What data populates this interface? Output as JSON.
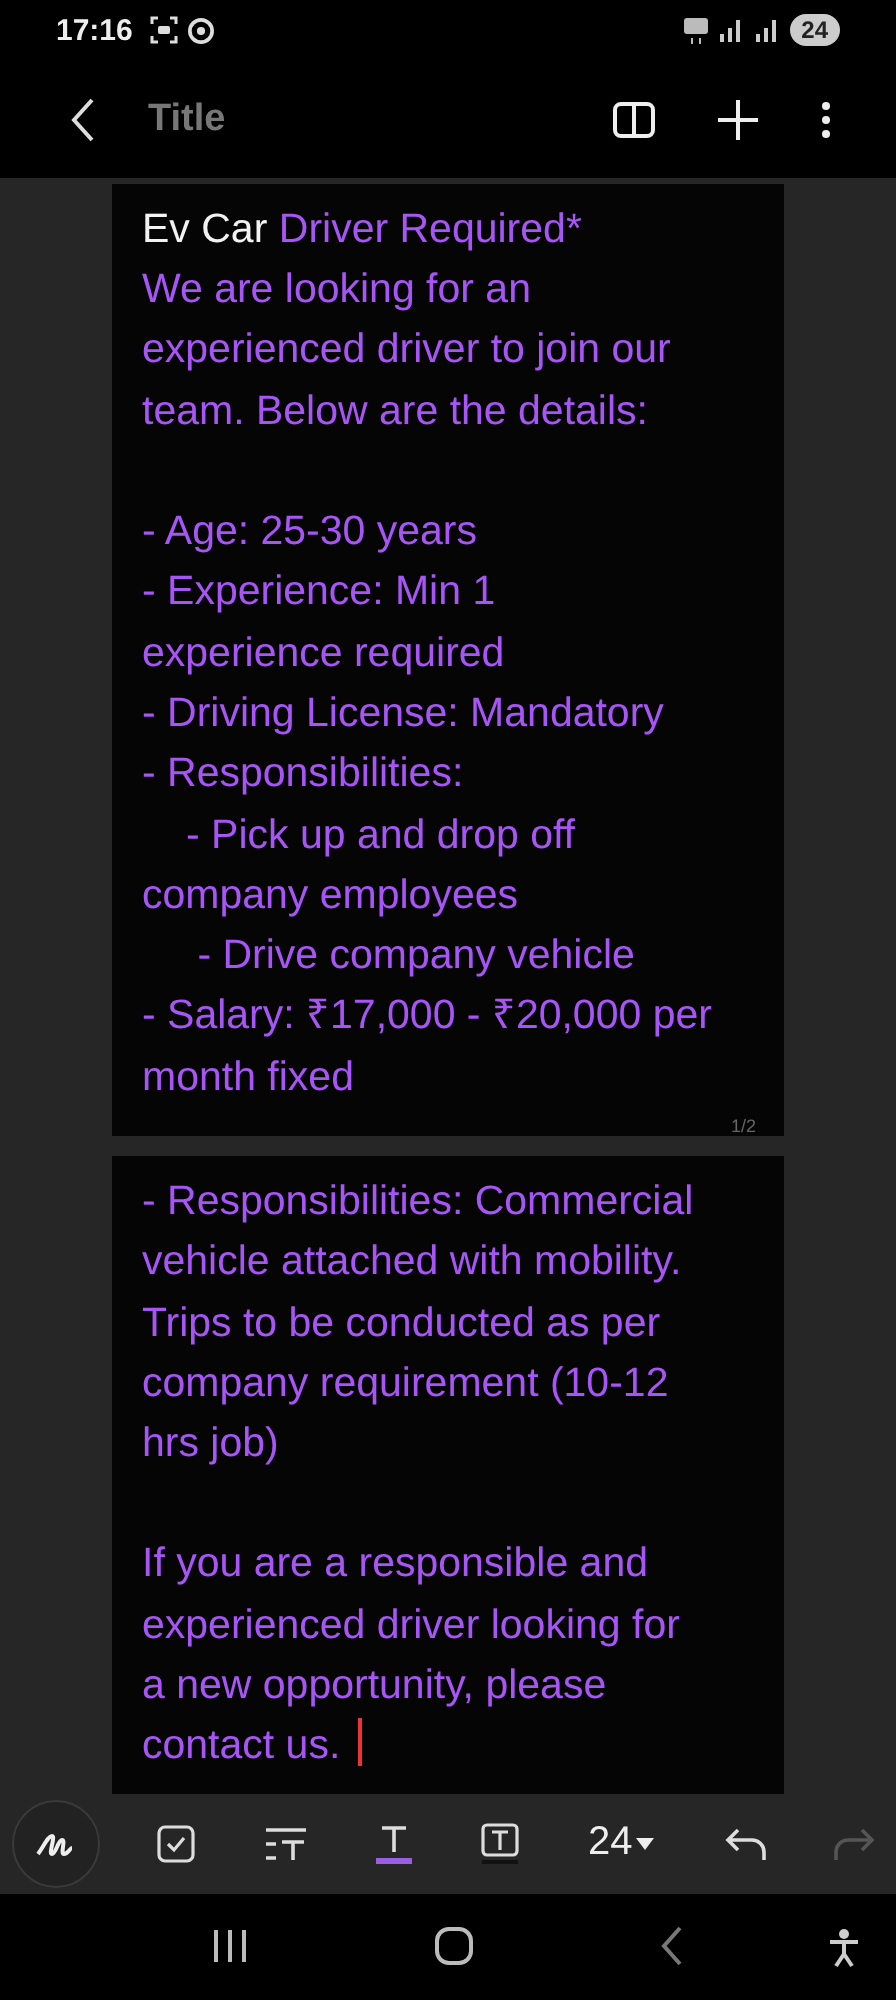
{
  "status_bar": {
    "time": "17:16",
    "battery": "24"
  },
  "header": {
    "title": "Title"
  },
  "pages": [
    {
      "page_number": "1/2",
      "paragraphs": [
        {
          "lines": [
            {
              "indented": false,
              "segments": [
                {
                  "text": "Ev Car",
                  "color": "#f2f2f2"
                },
                {
                  "text": "Driver Required*",
                  "color": "#a855f7"
                }
              ]
            },
            {
              "indented": false,
              "segments": [
                {
                  "text": "We are looking for an",
                  "color": "#a855f7"
                }
              ]
            },
            {
              "indented": false,
              "segments": [
                {
                  "text": "experienced driver to join our",
                  "color": "#a855f7"
                }
              ]
            },
            {
              "indented": false,
              "segments": [
                {
                  "text": "team. Below are the details:",
                  "color": "#a855f7"
                }
              ]
            }
          ]
        },
        {
          "lines": [
            {
              "indented": false,
              "segments": [
                {
                  "text": "- Age: 25-30 years",
                  "color": "#a855f7"
                }
              ]
            },
            {
              "indented": false,
              "segments": [
                {
                  "text": "- Experience: Min 1",
                  "color": "#a855f7"
                }
              ]
            },
            {
              "indented": false,
              "segments": [
                {
                  "text": "experience required",
                  "color": "#a855f7"
                }
              ]
            },
            {
              "indented": false,
              "segments": [
                {
                  "text": "- Driving License: Mandatory",
                  "color": "#a855f7"
                }
              ]
            },
            {
              "indented": false,
              "segments": [
                {
                  "text": "- Responsibilities:",
                  "color": "#a855f7"
                }
              ]
            },
            {
              "indented": true,
              "segments": [
                {
                  "text": "- Pick up and drop off",
                  "color": "#a855f7"
                }
              ]
            },
            {
              "indented": false,
              "segments": [
                {
                  "text": "company employees",
                  "color": "#a855f7"
                }
              ]
            },
            {
              "indented": true,
              "segments": [
                {
                  "text": " - Drive company vehicle",
                  "color": "#a855f7"
                }
              ]
            },
            {
              "indented": false,
              "segments": [
                {
                  "text": "- Salary: ₹17,000 - ₹20,000 per",
                  "color": "#a855f7"
                }
              ]
            },
            {
              "indented": false,
              "segments": [
                {
                  "text": "month fixed",
                  "color": "#a855f7"
                }
              ]
            }
          ]
        }
      ]
    },
    {
      "paragraphs": [
        {
          "lines": [
            {
              "indented": false,
              "segments": [
                {
                  "text": "- Responsibilities: Commercial",
                  "color": "#a855f7"
                }
              ]
            },
            {
              "indented": false,
              "segments": [
                {
                  "text": "vehicle attached with mobility.",
                  "color": "#a855f7"
                }
              ]
            },
            {
              "indented": false,
              "segments": [
                {
                  "text": "Trips to be conducted as per",
                  "color": "#a855f7"
                }
              ]
            },
            {
              "indented": false,
              "segments": [
                {
                  "text": "company requirement (10-12",
                  "color": "#a855f7"
                }
              ]
            },
            {
              "indented": false,
              "segments": [
                {
                  "text": "hrs job)",
                  "color": "#a855f7"
                }
              ]
            }
          ]
        },
        {
          "lines": [
            {
              "indented": false,
              "segments": [
                {
                  "text": "If you are a responsible and",
                  "color": "#a855f7"
                }
              ]
            },
            {
              "indented": false,
              "segments": [
                {
                  "text": "experienced driver looking for",
                  "color": "#a855f7"
                }
              ]
            },
            {
              "indented": false,
              "segments": [
                {
                  "text": "a new opportunity, please",
                  "color": "#a855f7"
                }
              ]
            },
            {
              "indented": false,
              "segments": [
                {
                  "text": "contact us.",
                  "color": "#a855f7"
                }
              ]
            }
          ]
        }
      ]
    }
  ],
  "toolbar": {
    "font_size": "24"
  }
}
